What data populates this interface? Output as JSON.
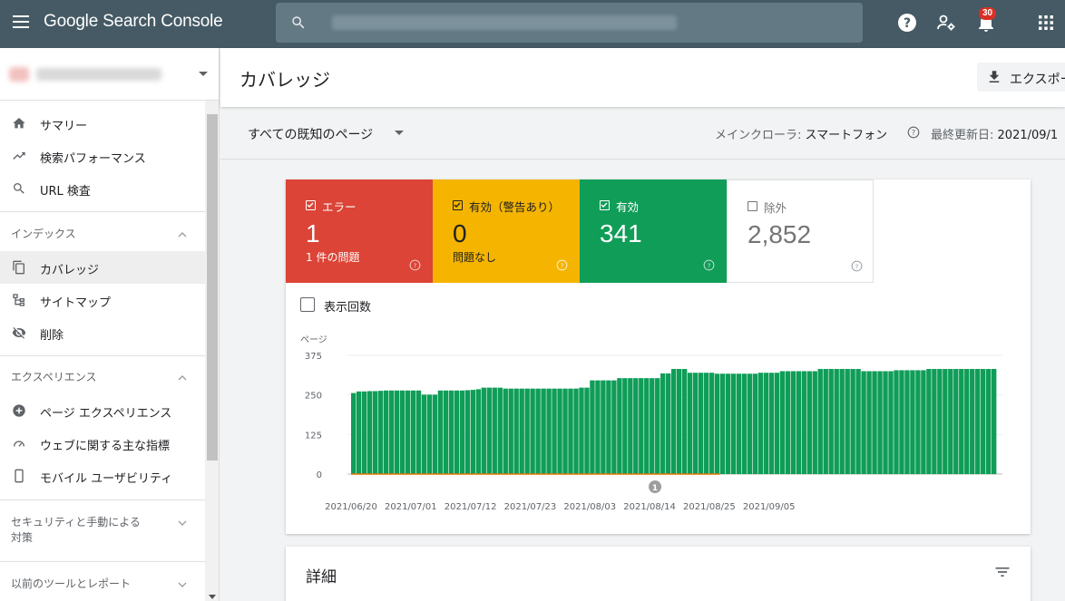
{
  "app": {
    "title": "Google Search Console"
  },
  "topbar": {
    "notification_count": "30"
  },
  "sidebar": {
    "items": [
      {
        "label": "サマリー",
        "icon": "home-icon"
      },
      {
        "label": "検索パフォーマンス",
        "icon": "trending-up-icon"
      },
      {
        "label": "URL 検査",
        "icon": "search-icon"
      },
      {
        "label": "カバレッジ",
        "icon": "coverage-icon",
        "active": true
      },
      {
        "label": "サイトマップ",
        "icon": "sitemap-icon"
      },
      {
        "label": "削除",
        "icon": "visibility-off-icon"
      },
      {
        "label": "ページ エクスペリエンス",
        "icon": "page-experience-icon"
      },
      {
        "label": "ウェブに関する主な指標",
        "icon": "speed-icon"
      },
      {
        "label": "モバイル ユーザビリティ",
        "icon": "smartphone-icon"
      }
    ],
    "sections": [
      {
        "label": "インデックス",
        "expanded": true
      },
      {
        "label": "エクスペリエンス",
        "expanded": true
      },
      {
        "label": "セキュリティと手動による対策",
        "expanded": false
      },
      {
        "label": "以前のツールとレポート",
        "expanded": false
      }
    ]
  },
  "header": {
    "title": "カバレッジ",
    "export_label": "エクスポート"
  },
  "filters": {
    "page_filter": "すべての既知のページ",
    "crawler_label": "メインクローラ:",
    "crawler_value": "スマートフォン",
    "updated_label": "最終更新日:",
    "updated_value": "2021/09/1"
  },
  "tiles": {
    "error": {
      "label": "エラー",
      "value": "1",
      "sub": "1 件の問題",
      "color": "#db4437",
      "checked": true
    },
    "warning": {
      "label": "有効（警告あり）",
      "value": "0",
      "sub": "問題なし",
      "color": "#f4b400",
      "checked": true
    },
    "valid": {
      "label": "有効",
      "value": "341",
      "sub": "",
      "color": "#0f9d58",
      "checked": true
    },
    "excluded": {
      "label": "除外",
      "value": "2,852",
      "sub": "",
      "color": "#757575",
      "checked": false
    }
  },
  "impressions": {
    "label": "表示回数",
    "checked": false
  },
  "details": {
    "title": "詳細"
  },
  "chart_data": {
    "type": "bar",
    "ylabel": "ページ",
    "yticks": [
      0,
      125,
      250,
      375
    ],
    "ylim": [
      0,
      375
    ],
    "xticks": [
      "2021/06/20",
      "2021/07/01",
      "2021/07/12",
      "2021/07/23",
      "2021/08/03",
      "2021/08/14",
      "2021/08/25",
      "2021/09/05"
    ],
    "annotation": {
      "label": "1",
      "date": "2021/08/15"
    },
    "series": [
      {
        "name": "有効",
        "color": "#0f9d58",
        "values": [
          256,
          261,
          261,
          262,
          262,
          263,
          264,
          264,
          264,
          264,
          264,
          264,
          264,
          251,
          251,
          251,
          264,
          264,
          264,
          264,
          264,
          265,
          266,
          268,
          273,
          273,
          273,
          273,
          270,
          270,
          270,
          270,
          270,
          270,
          270,
          270,
          270,
          270,
          270,
          270,
          270,
          270,
          273,
          273,
          296,
          296,
          296,
          296,
          296,
          303,
          303,
          303,
          303,
          303,
          303,
          303,
          303,
          318,
          318,
          332,
          332,
          332,
          320,
          320,
          320,
          320,
          320,
          317,
          317,
          317,
          317,
          317,
          317,
          317,
          317,
          320,
          320,
          320,
          320,
          325,
          325,
          325,
          325,
          325,
          325,
          325,
          332,
          332,
          332,
          332,
          332,
          332,
          332,
          332,
          325,
          325,
          325,
          325,
          325,
          325,
          328,
          328,
          328,
          328,
          328,
          328,
          332,
          332,
          332,
          332,
          332,
          332,
          332,
          332,
          332,
          332,
          332,
          332,
          332
        ]
      },
      {
        "name": "エラー",
        "color": "#db4437",
        "values_note": "baseline"
      }
    ]
  }
}
